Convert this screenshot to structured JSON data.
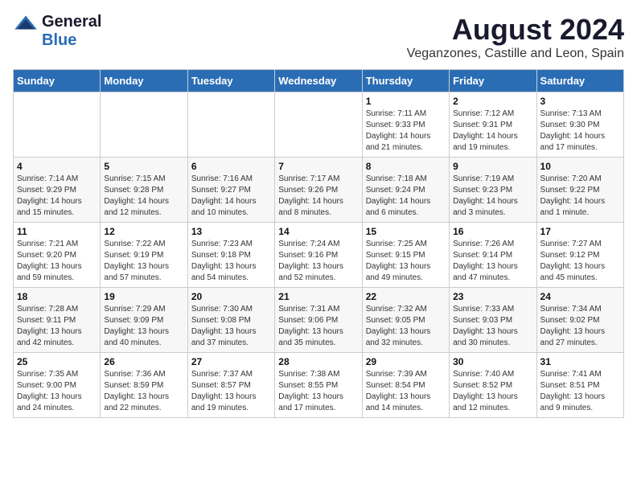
{
  "header": {
    "logo_general": "General",
    "logo_blue": "Blue",
    "month": "August 2024",
    "location": "Veganzones, Castille and Leon, Spain"
  },
  "weekdays": [
    "Sunday",
    "Monday",
    "Tuesday",
    "Wednesday",
    "Thursday",
    "Friday",
    "Saturday"
  ],
  "weeks": [
    [
      {
        "day": "",
        "info": ""
      },
      {
        "day": "",
        "info": ""
      },
      {
        "day": "",
        "info": ""
      },
      {
        "day": "",
        "info": ""
      },
      {
        "day": "1",
        "info": "Sunrise: 7:11 AM\nSunset: 9:33 PM\nDaylight: 14 hours\nand 21 minutes."
      },
      {
        "day": "2",
        "info": "Sunrise: 7:12 AM\nSunset: 9:31 PM\nDaylight: 14 hours\nand 19 minutes."
      },
      {
        "day": "3",
        "info": "Sunrise: 7:13 AM\nSunset: 9:30 PM\nDaylight: 14 hours\nand 17 minutes."
      }
    ],
    [
      {
        "day": "4",
        "info": "Sunrise: 7:14 AM\nSunset: 9:29 PM\nDaylight: 14 hours\nand 15 minutes."
      },
      {
        "day": "5",
        "info": "Sunrise: 7:15 AM\nSunset: 9:28 PM\nDaylight: 14 hours\nand 12 minutes."
      },
      {
        "day": "6",
        "info": "Sunrise: 7:16 AM\nSunset: 9:27 PM\nDaylight: 14 hours\nand 10 minutes."
      },
      {
        "day": "7",
        "info": "Sunrise: 7:17 AM\nSunset: 9:26 PM\nDaylight: 14 hours\nand 8 minutes."
      },
      {
        "day": "8",
        "info": "Sunrise: 7:18 AM\nSunset: 9:24 PM\nDaylight: 14 hours\nand 6 minutes."
      },
      {
        "day": "9",
        "info": "Sunrise: 7:19 AM\nSunset: 9:23 PM\nDaylight: 14 hours\nand 3 minutes."
      },
      {
        "day": "10",
        "info": "Sunrise: 7:20 AM\nSunset: 9:22 PM\nDaylight: 14 hours\nand 1 minute."
      }
    ],
    [
      {
        "day": "11",
        "info": "Sunrise: 7:21 AM\nSunset: 9:20 PM\nDaylight: 13 hours\nand 59 minutes."
      },
      {
        "day": "12",
        "info": "Sunrise: 7:22 AM\nSunset: 9:19 PM\nDaylight: 13 hours\nand 57 minutes."
      },
      {
        "day": "13",
        "info": "Sunrise: 7:23 AM\nSunset: 9:18 PM\nDaylight: 13 hours\nand 54 minutes."
      },
      {
        "day": "14",
        "info": "Sunrise: 7:24 AM\nSunset: 9:16 PM\nDaylight: 13 hours\nand 52 minutes."
      },
      {
        "day": "15",
        "info": "Sunrise: 7:25 AM\nSunset: 9:15 PM\nDaylight: 13 hours\nand 49 minutes."
      },
      {
        "day": "16",
        "info": "Sunrise: 7:26 AM\nSunset: 9:14 PM\nDaylight: 13 hours\nand 47 minutes."
      },
      {
        "day": "17",
        "info": "Sunrise: 7:27 AM\nSunset: 9:12 PM\nDaylight: 13 hours\nand 45 minutes."
      }
    ],
    [
      {
        "day": "18",
        "info": "Sunrise: 7:28 AM\nSunset: 9:11 PM\nDaylight: 13 hours\nand 42 minutes."
      },
      {
        "day": "19",
        "info": "Sunrise: 7:29 AM\nSunset: 9:09 PM\nDaylight: 13 hours\nand 40 minutes."
      },
      {
        "day": "20",
        "info": "Sunrise: 7:30 AM\nSunset: 9:08 PM\nDaylight: 13 hours\nand 37 minutes."
      },
      {
        "day": "21",
        "info": "Sunrise: 7:31 AM\nSunset: 9:06 PM\nDaylight: 13 hours\nand 35 minutes."
      },
      {
        "day": "22",
        "info": "Sunrise: 7:32 AM\nSunset: 9:05 PM\nDaylight: 13 hours\nand 32 minutes."
      },
      {
        "day": "23",
        "info": "Sunrise: 7:33 AM\nSunset: 9:03 PM\nDaylight: 13 hours\nand 30 minutes."
      },
      {
        "day": "24",
        "info": "Sunrise: 7:34 AM\nSunset: 9:02 PM\nDaylight: 13 hours\nand 27 minutes."
      }
    ],
    [
      {
        "day": "25",
        "info": "Sunrise: 7:35 AM\nSunset: 9:00 PM\nDaylight: 13 hours\nand 24 minutes."
      },
      {
        "day": "26",
        "info": "Sunrise: 7:36 AM\nSunset: 8:59 PM\nDaylight: 13 hours\nand 22 minutes."
      },
      {
        "day": "27",
        "info": "Sunrise: 7:37 AM\nSunset: 8:57 PM\nDaylight: 13 hours\nand 19 minutes."
      },
      {
        "day": "28",
        "info": "Sunrise: 7:38 AM\nSunset: 8:55 PM\nDaylight: 13 hours\nand 17 minutes."
      },
      {
        "day": "29",
        "info": "Sunrise: 7:39 AM\nSunset: 8:54 PM\nDaylight: 13 hours\nand 14 minutes."
      },
      {
        "day": "30",
        "info": "Sunrise: 7:40 AM\nSunset: 8:52 PM\nDaylight: 13 hours\nand 12 minutes."
      },
      {
        "day": "31",
        "info": "Sunrise: 7:41 AM\nSunset: 8:51 PM\nDaylight: 13 hours\nand 9 minutes."
      }
    ]
  ]
}
